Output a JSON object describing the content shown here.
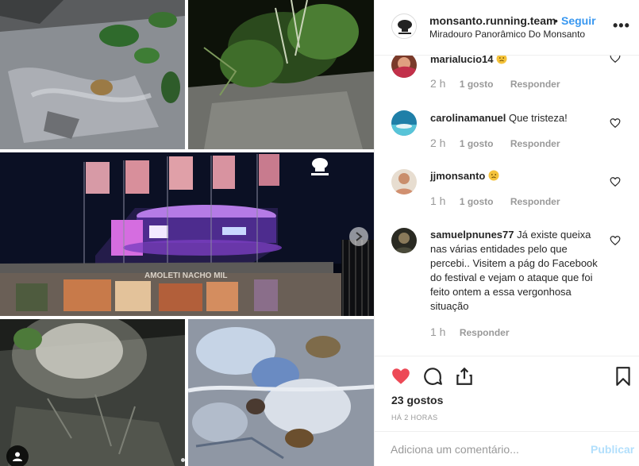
{
  "post": {
    "username": "monsanto.running.team",
    "separator": "•",
    "follow_label": "Seguir",
    "location": "Miradouro Panorâmico Do Monsanto",
    "more_label": "•••"
  },
  "comments": [
    {
      "user": "marialucio14",
      "text": "",
      "emoji": "disappointed-face",
      "time": "2 h",
      "likes": "1 gosto",
      "reply": "Responder"
    },
    {
      "user": "carolinamanuel",
      "text": "Que tristeza!",
      "emoji": "",
      "time": "2 h",
      "likes": "1 gosto",
      "reply": "Responder"
    },
    {
      "user": "jjmonsanto",
      "text": "",
      "emoji": "disappointed-face",
      "time": "1 h",
      "likes": "1 gosto",
      "reply": "Responder"
    },
    {
      "user": "samuelpnunes77",
      "text": "Já existe queixa nas várias entidades pelo que percebi.. Visitem a pág do Facebook do festival e vejam o ataque que foi feito ontem a essa vergonhosa situação",
      "emoji": "",
      "time": "1 h",
      "likes": "",
      "reply": "Responder"
    }
  ],
  "actions": {
    "likes_count": "23 gostos",
    "posted": "HÁ 2 HORAS",
    "liked": true,
    "like_color": "#ed4956"
  },
  "composer": {
    "placeholder": "Adiciona um comentário...",
    "publish_label": "Publicar"
  },
  "media": {
    "banner_logo_text": "monsanto",
    "wall_text": "AMOLETI NACHO MIL"
  },
  "colors": {
    "link": "#3897f0",
    "muted": "#999999",
    "publish_disabled": "#b2dffc"
  }
}
